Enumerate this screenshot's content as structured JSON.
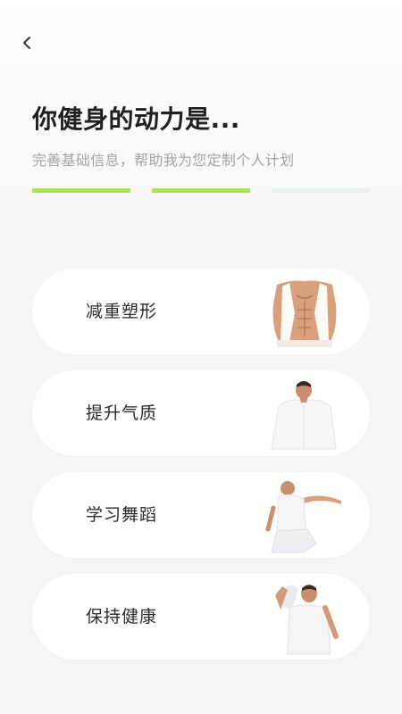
{
  "header": {
    "back_icon": "chevron-left-icon",
    "title": "你健身的动力是...",
    "subtitle": "完善基础信息，帮助我为您定制个人计划"
  },
  "progress": {
    "total_steps": 3,
    "current_step": 2,
    "active_color": "#a6e74c",
    "inactive_color": "#ecf0ec"
  },
  "options": [
    {
      "label": "减重塑形",
      "image": "muscular-torso-photo"
    },
    {
      "label": "提升气质",
      "image": "man-white-shirt-photo"
    },
    {
      "label": "学习舞蹈",
      "image": "dancer-photo"
    },
    {
      "label": "保持健康",
      "image": "man-stretching-photo"
    }
  ]
}
